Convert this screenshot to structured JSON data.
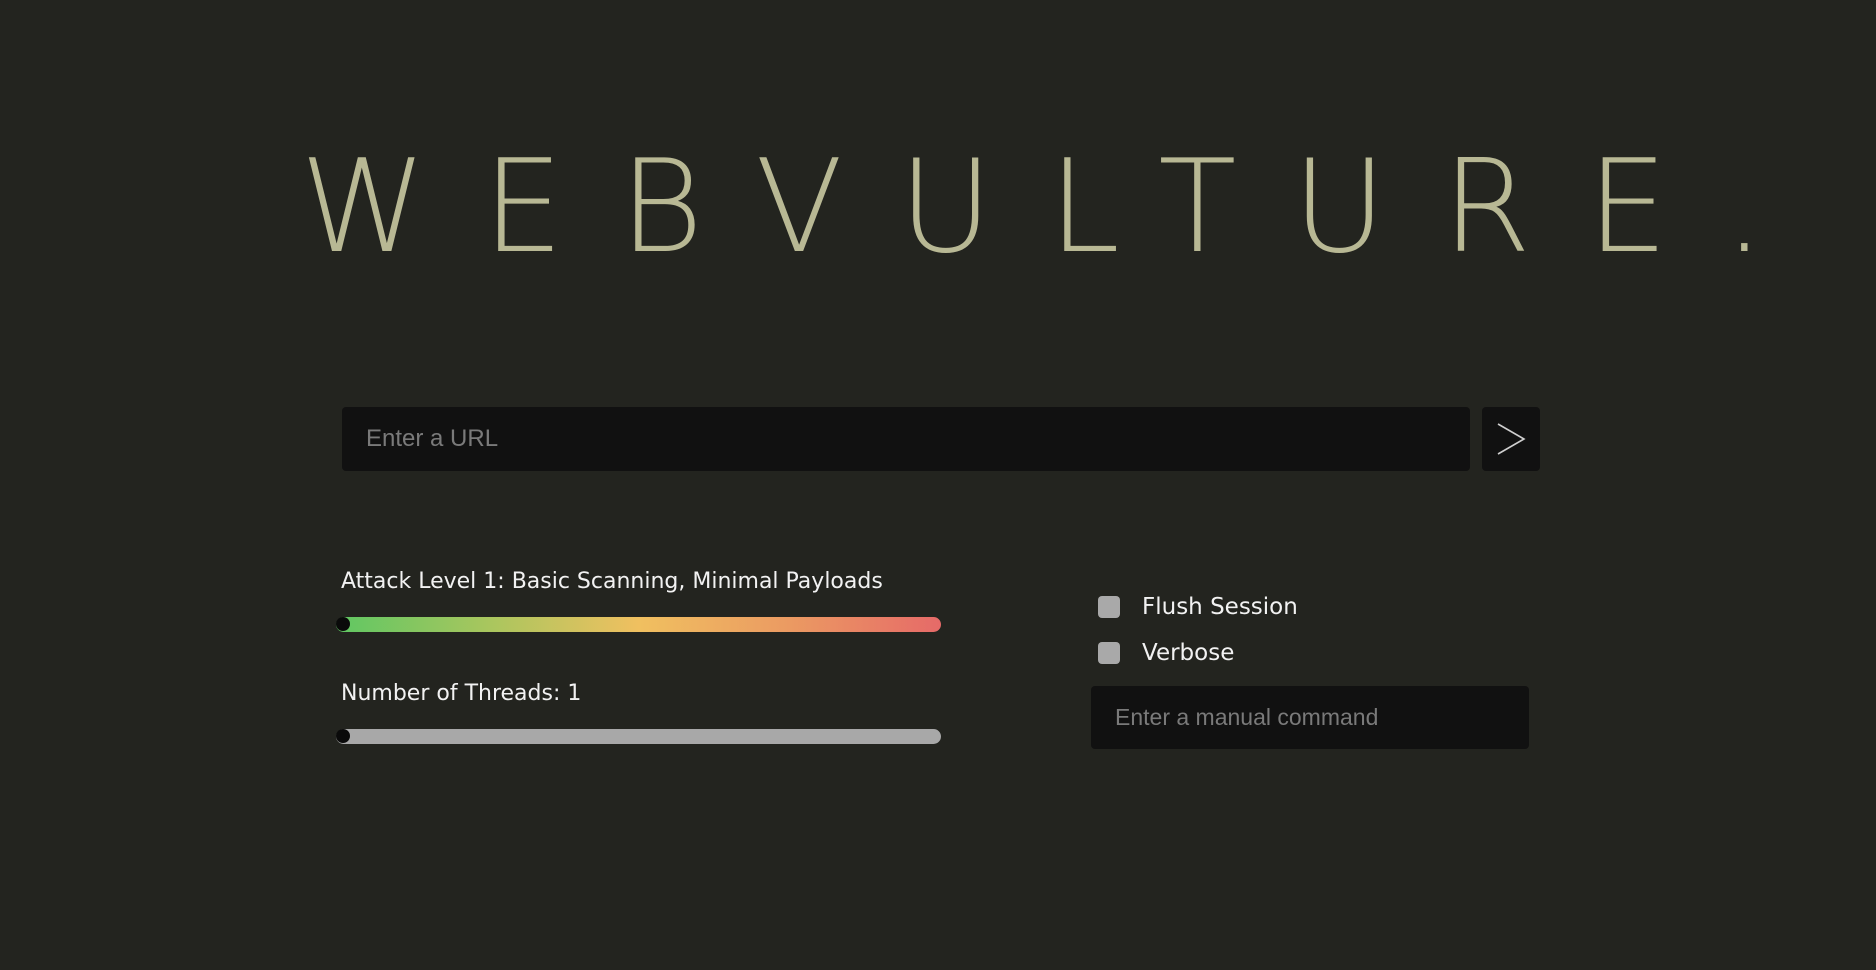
{
  "app": {
    "logo": "WEBVULTURE."
  },
  "url_bar": {
    "placeholder": "Enter a URL",
    "value": "",
    "submit_icon": "chevron-right-icon"
  },
  "attack_level": {
    "label": "Attack Level 1: Basic Scanning, Minimal Payloads",
    "value": 1,
    "gradient_colors": [
      "#5fc763",
      "#f0c060",
      "#e66a68"
    ]
  },
  "threads": {
    "label": "Number of Threads: 1",
    "value": 1,
    "track_color": "#a8a8a8"
  },
  "options": [
    {
      "label": "Flush Session",
      "checked": false
    },
    {
      "label": "Verbose",
      "checked": false
    }
  ],
  "manual_command": {
    "placeholder": "Enter a manual command",
    "value": ""
  },
  "colors": {
    "background": "#23241f",
    "logo": "#b8b894",
    "input_background": "#111111"
  }
}
